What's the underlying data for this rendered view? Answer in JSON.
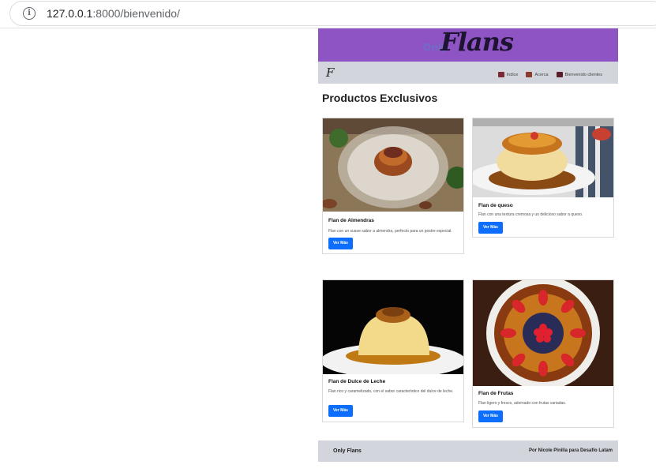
{
  "browser": {
    "url_host": "127.0.0.1",
    "url_rest": ":8000/bienvenido/"
  },
  "header": {
    "logo_prefix": "Only",
    "logo_main": "Flans",
    "brand_icon": "F",
    "nav": [
      {
        "label": "Indice",
        "icon": "home-icon"
      },
      {
        "label": "Acerca",
        "icon": "info-card-icon"
      },
      {
        "label": "Bienvenido clientes",
        "icon": "door-icon"
      }
    ]
  },
  "main": {
    "section_title": "Productos Exclusivos",
    "products": [
      {
        "title": "Flan de Almendras",
        "description": "Flan con un suave sabor a almendra, perfecto para un postre especial.",
        "button": "Ver Más"
      },
      {
        "title": "Flan de queso",
        "description": "Flan con una textura cremosa y un delicioso sabor a queso.",
        "button": "Ver Más"
      },
      {
        "title": "Flan de Dulce de Leche",
        "description": "Flan rico y caramelizado, con el sabor característico del dulce de leche.",
        "button": "Ver Más"
      },
      {
        "title": "Flan de Frutas",
        "description": "Flan ligero y fresco, adornado con frutas variadas.",
        "button": "Ver Más"
      }
    ]
  },
  "footer": {
    "brand": "Only Flans",
    "credit": "Por Nicole Pinilla para Desafío Latam"
  },
  "colors": {
    "hero": "#8f54c4",
    "navbar": "#d2d6dc",
    "button": "#0d6efd"
  }
}
